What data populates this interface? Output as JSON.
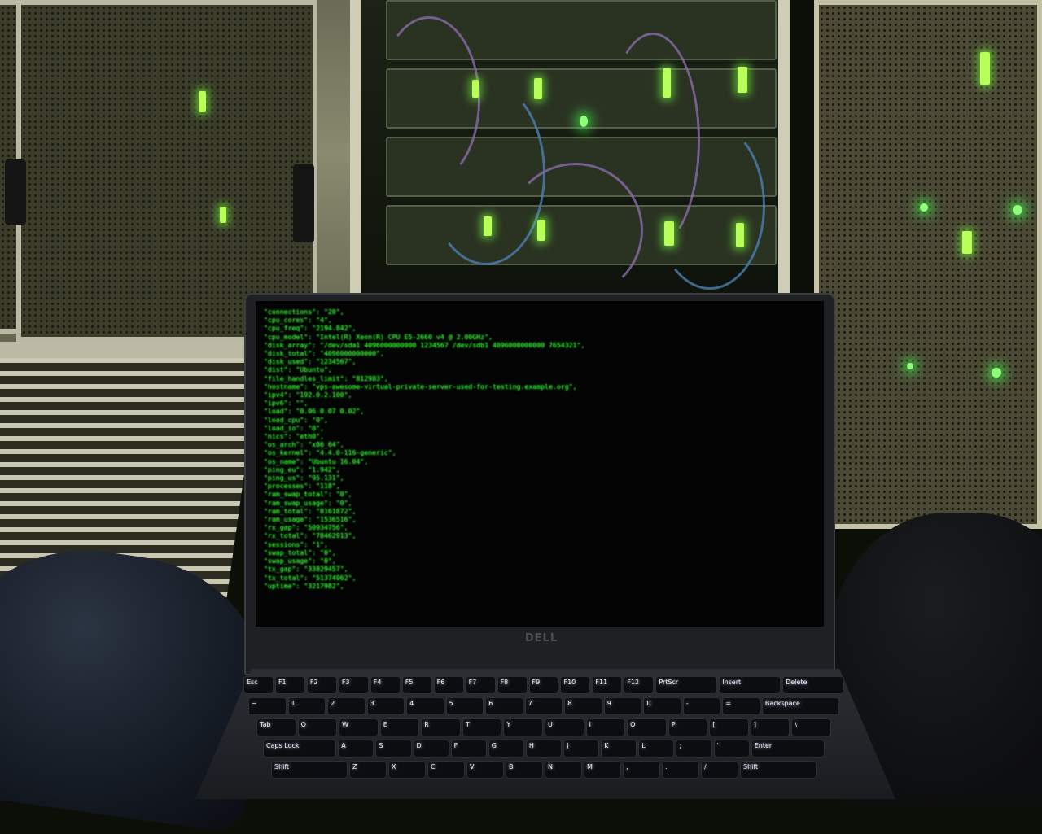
{
  "scene": {
    "description_tags": [
      "data-center",
      "server-rack",
      "laptop-on-lap",
      "terminal"
    ],
    "accent_color": "#3bff3b",
    "led_color": "#b9ff5a"
  },
  "laptop": {
    "brand": "DELL",
    "terminal_lines": [
      "\"connections\": \"20\",",
      "\"cpu_cores\": \"4\",",
      "\"cpu_freq\": \"2194.842\",",
      "\"cpu_model\": \"Intel(R) Xeon(R) CPU E5-2660 v4 @ 2.00GHz\",",
      "\"disk_array\": \"/dev/sda1 4096000000000 1234567 /dev/sdb1 4096000000000 7654321\",",
      "\"disk_total\": \"4096000000000\",",
      "\"disk_used\": \"1234567\",",
      "\"dist\": \"Ubuntu\",",
      "\"file_handles_limit\": \"812983\",",
      "\"hostname\": \"vps-awesome-virtual-private-server-used-for-testing.example.org\",",
      "\"ipv4\": \"192.0.2.100\",",
      "\"ipv6\": \"\",",
      "\"load\": \"0.06 0.07 0.02\",",
      "\"load_cpu\": \"0\",",
      "\"load_io\": \"0\",",
      "\"nics\": \"eth0\",",
      "\"os_arch\": \"x86_64\",",
      "\"os_kernel\": \"4.4.0-116-generic\",",
      "\"os_name\": \"Ubuntu 16.04\",",
      "\"ping_eu\": \"1.942\",",
      "\"ping_us\": \"95.131\",",
      "\"processes\": \"118\",",
      "\"ram_swap_total\": \"0\",",
      "\"ram_swap_usage\": \"0\",",
      "\"ram_total\": \"8161872\",",
      "\"ram_usage\": \"1536516\",",
      "\"rx_gap\": \"50934756\",",
      "\"rx_total\": \"78462913\",",
      "\"sessions\": \"1\",",
      "\"swap_total\": \"0\",",
      "\"swap_usage\": \"0\",",
      "\"tx_gap\": \"33829457\",",
      "\"tx_total\": \"51374962\",",
      "\"uptime\": \"3217982\","
    ],
    "keyboard": {
      "rows": [
        [
          "Esc",
          "F1",
          "F2",
          "F3",
          "F4",
          "F5",
          "F6",
          "F7",
          "F8",
          "F9",
          "F10",
          "F11",
          "F12",
          "PrtScr",
          "Insert",
          "Delete"
        ],
        [
          "~",
          "1",
          "2",
          "3",
          "4",
          "5",
          "6",
          "7",
          "8",
          "9",
          "0",
          "-",
          "=",
          "Backspace"
        ],
        [
          "Tab",
          "Q",
          "W",
          "E",
          "R",
          "T",
          "Y",
          "U",
          "I",
          "O",
          "P",
          "[",
          "]",
          "\\"
        ],
        [
          "Caps Lock",
          "A",
          "S",
          "D",
          "F",
          "G",
          "H",
          "J",
          "K",
          "L",
          ";",
          "'",
          "Enter"
        ],
        [
          "Shift",
          "Z",
          "X",
          "C",
          "V",
          "B",
          "N",
          "M",
          ",",
          ".",
          "/",
          "Shift"
        ]
      ]
    }
  }
}
